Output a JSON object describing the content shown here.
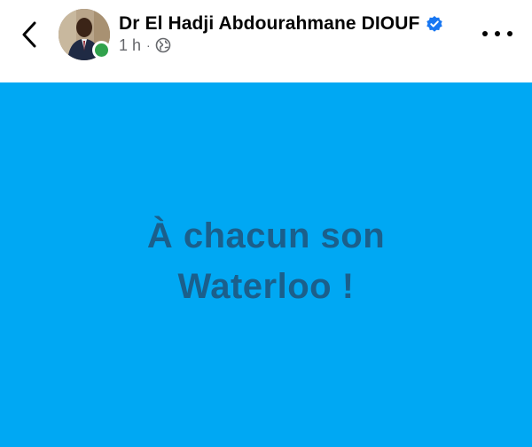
{
  "header": {
    "author_name": "Dr El Hadji Abdourahmane DIOUF",
    "time": "1 h",
    "separator": "·",
    "verified": true,
    "online": true,
    "privacy_icon": "globe-icon",
    "back_icon": "chevron-left-icon",
    "more_icon": "more-horizontal-icon"
  },
  "post": {
    "line1": "À chacun son",
    "line2": "Waterloo !",
    "background_color": "#00a8f3",
    "text_color": "#1b5f8b"
  },
  "colors": {
    "online_dot": "#31a24c",
    "verified_badge": "#1877f2",
    "meta_text": "#65676b"
  }
}
